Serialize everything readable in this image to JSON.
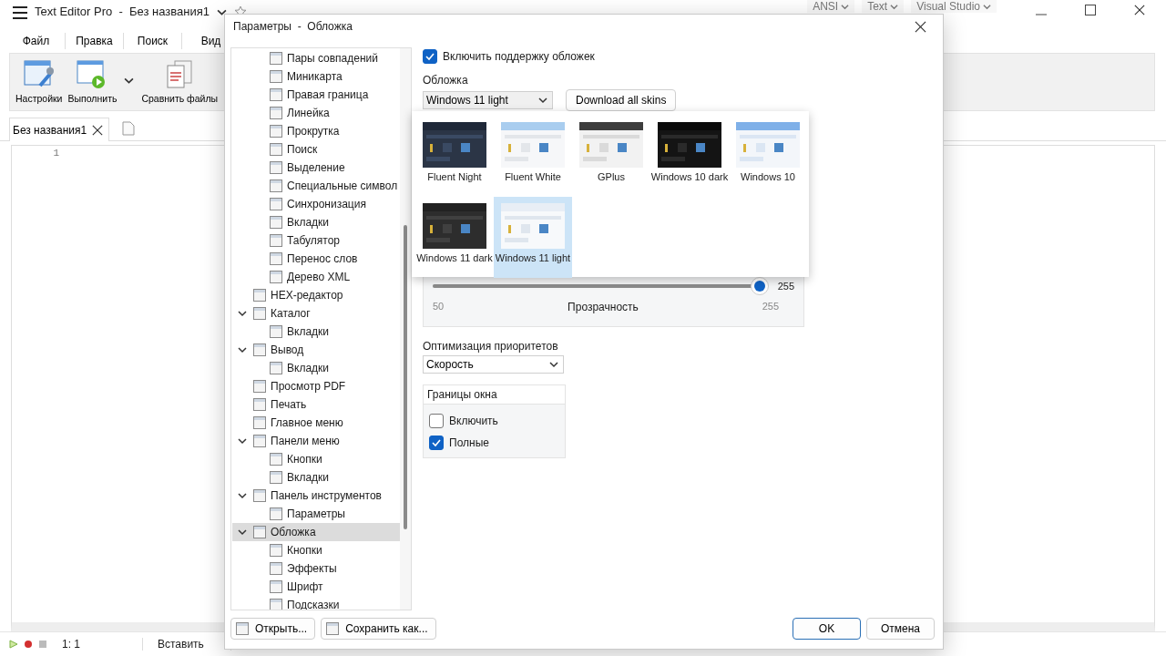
{
  "app": {
    "title": "Text Editor Pro  -  Без названия1",
    "title_buttons": [
      {
        "label": "ANSI"
      },
      {
        "label": "Text"
      },
      {
        "label": "Visual Studio"
      }
    ]
  },
  "menu_tabs": [
    {
      "label": "Файл"
    },
    {
      "label": "Правка"
    },
    {
      "label": "Поиск"
    },
    {
      "label": "Вид"
    }
  ],
  "ribbon": [
    {
      "label": "Настройки",
      "kind": "settings",
      "dropdown": false
    },
    {
      "label": "Выполнить",
      "kind": "run",
      "dropdown": true
    },
    {
      "label": "Сравнить файлы",
      "kind": "compare",
      "dropdown": false
    }
  ],
  "doc_tabs": [
    {
      "label": "Без названия1",
      "selected": true
    }
  ],
  "editor": {
    "line_numbers": [
      "1"
    ]
  },
  "status_bar": {
    "position": "1: 1",
    "mode": "Вставить"
  },
  "dialog": {
    "title": "Параметры  -  Обложка",
    "tree": [
      {
        "children": [
          {
            "label": "Пары совпадений",
            "selected": false
          },
          {
            "label": "Миникарта",
            "selected": false
          },
          {
            "label": "Правая граница",
            "selected": false
          },
          {
            "label": "Линейка",
            "selected": false
          },
          {
            "label": "Прокрутка",
            "selected": false
          },
          {
            "label": "Поиск",
            "selected": false
          },
          {
            "label": "Выделение",
            "selected": false
          },
          {
            "label": "Специальные символ",
            "selected": false
          },
          {
            "label": "Синхронизация",
            "selected": false
          },
          {
            "label": "Вкладки",
            "selected": false
          },
          {
            "label": "Табулятор",
            "selected": false
          },
          {
            "label": "Перенос слов",
            "selected": false
          },
          {
            "label": "Дерево XML",
            "selected": false
          }
        ]
      },
      {
        "label": "HEX-редактор",
        "selected": false
      },
      {
        "label": "Каталог",
        "selected": false,
        "expanded": true,
        "children": [
          {
            "label": "Вкладки",
            "selected": false
          }
        ]
      },
      {
        "label": "Вывод",
        "selected": false,
        "expanded": true,
        "children": [
          {
            "label": "Вкладки",
            "selected": false
          }
        ]
      },
      {
        "label": "Просмотр PDF",
        "selected": false
      },
      {
        "label": "Печать",
        "selected": false
      },
      {
        "label": "Главное меню",
        "selected": false
      },
      {
        "label": "Панели меню",
        "selected": false,
        "expanded": true,
        "children": [
          {
            "label": "Кнопки",
            "selected": false
          },
          {
            "label": "Вкладки",
            "selected": false
          }
        ]
      },
      {
        "label": "Панель инструментов",
        "selected": false,
        "expanded": true,
        "children": [
          {
            "label": "Параметры",
            "selected": false
          }
        ]
      },
      {
        "label": "Обложка",
        "selected": true,
        "expanded": true,
        "children": [
          {
            "label": "Кнопки",
            "selected": false
          },
          {
            "label": "Эффекты",
            "selected": false
          },
          {
            "label": "Шрифт",
            "selected": false
          },
          {
            "label": "Подсказки",
            "selected": false
          }
        ]
      }
    ],
    "enable_skins": {
      "label": "Включить поддержку обложек",
      "checked": true
    },
    "skin": {
      "label": "Обложка",
      "value": "Windows 11 light",
      "button": "Download all skins",
      "options": [
        {
          "name": "Fluent Night",
          "kind": "night",
          "selected": false
        },
        {
          "name": "Fluent White",
          "kind": "white",
          "selected": false
        },
        {
          "name": "GPlus",
          "kind": "gplus",
          "selected": false
        },
        {
          "name": "Windows 10 dark",
          "kind": "black",
          "selected": false
        },
        {
          "name": "Windows 10",
          "kind": "blue",
          "selected": false
        },
        {
          "name": "Windows 11 dark",
          "kind": "dark",
          "selected": false
        },
        {
          "name": "Windows 11 light",
          "kind": "light",
          "selected": true
        }
      ]
    },
    "transparency": {
      "title": "Прозрачность",
      "min": "50",
      "max": "255",
      "value": "255",
      "level": 1
    },
    "priority": {
      "label": "Оптимизация приоритетов",
      "value": "Скорость"
    },
    "borders": {
      "title": "Границы окна",
      "options": [
        {
          "label": "Включить",
          "checked": false
        },
        {
          "label": "Полные",
          "checked": true
        }
      ]
    },
    "footer": {
      "left_buttons": [
        "Открыть...",
        "Сохранить как..."
      ],
      "buttons": [
        {
          "label": "OK",
          "default": true
        },
        {
          "label": "Отмена",
          "default": false
        }
      ]
    }
  }
}
